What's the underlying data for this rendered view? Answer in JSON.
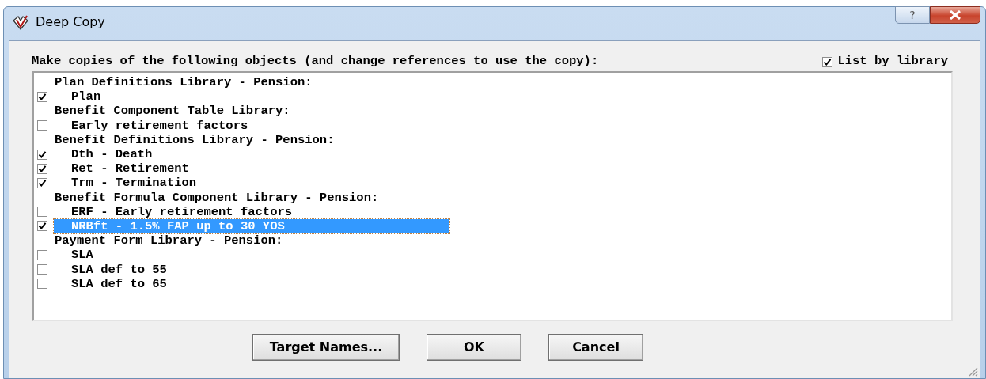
{
  "window": {
    "title": "Deep Copy",
    "help_button": "?"
  },
  "instruction": "Make copies of the following objects (and change references to use the copy):",
  "list_by_library": {
    "label": "List by library",
    "checked": true
  },
  "objects": [
    {
      "kind": "header",
      "label": "Plan Definitions Library - Pension:"
    },
    {
      "kind": "item",
      "label": "Plan",
      "checked": true,
      "selected": false
    },
    {
      "kind": "header",
      "label": "Benefit Component Table Library:"
    },
    {
      "kind": "item",
      "label": "Early retirement factors",
      "checked": false,
      "selected": false
    },
    {
      "kind": "header",
      "label": "Benefit Definitions Library - Pension:"
    },
    {
      "kind": "item",
      "label": "Dth - Death",
      "checked": true,
      "selected": false
    },
    {
      "kind": "item",
      "label": "Ret - Retirement",
      "checked": true,
      "selected": false
    },
    {
      "kind": "item",
      "label": "Trm - Termination",
      "checked": true,
      "selected": false
    },
    {
      "kind": "header",
      "label": "Benefit Formula Component Library - Pension:"
    },
    {
      "kind": "item",
      "label": "ERF - Early retirement factors",
      "checked": false,
      "selected": false
    },
    {
      "kind": "item",
      "label": "NRBft - 1.5% FAP up to 30 YOS",
      "checked": true,
      "selected": true
    },
    {
      "kind": "header",
      "label": "Payment Form Library - Pension:"
    },
    {
      "kind": "item",
      "label": "SLA",
      "checked": false,
      "selected": false
    },
    {
      "kind": "item",
      "label": "SLA def to 55",
      "checked": false,
      "selected": false
    },
    {
      "kind": "item",
      "label": "SLA def to 65",
      "checked": false,
      "selected": false
    }
  ],
  "buttons": [
    "Target Names...",
    "OK",
    "Cancel"
  ]
}
